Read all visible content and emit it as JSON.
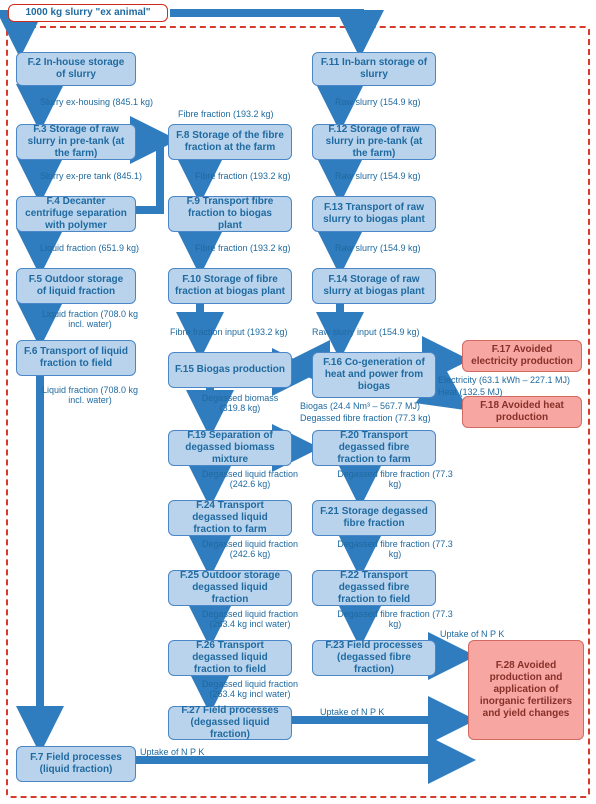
{
  "colors": {
    "node_blue": "#b9d3ec",
    "node_red": "#f7a6a1",
    "edge": "#2f7cbf",
    "border_dash": "#d63b2c"
  },
  "start": {
    "label": "1000 kg slurry \"ex animal\""
  },
  "nodes": {
    "f2": {
      "label": "F.2 In-house storage of slurry"
    },
    "f3": {
      "label": "F.3 Storage of raw slurry in pre-tank (at the farm)"
    },
    "f4": {
      "label": "F.4 Decanter centrifuge separation with polymer"
    },
    "f5": {
      "label": "F.5 Outdoor storage of liquid fraction"
    },
    "f6": {
      "label": "F.6 Transport of liquid fraction to field"
    },
    "f7": {
      "label": "F.7 Field processes (liquid fraction)"
    },
    "f8": {
      "label": "F.8 Storage of the fibre fraction at the farm"
    },
    "f9": {
      "label": "F.9 Transport fibre fraction to biogas plant"
    },
    "f10": {
      "label": "F.10 Storage of fibre fraction at biogas plant"
    },
    "f11": {
      "label": "F.11 In-barn storage of slurry"
    },
    "f12": {
      "label": "F.12 Storage of raw slurry in pre-tank (at the farm)"
    },
    "f13": {
      "label": "F.13 Transport of raw slurry to biogas plant"
    },
    "f14": {
      "label": "F.14 Storage of raw slurry at biogas plant"
    },
    "f15": {
      "label": "F.15 Biogas production"
    },
    "f16": {
      "label": "F.16 Co-generation of heat and power from biogas"
    },
    "f17": {
      "label": "F.17 Avoided electricity production"
    },
    "f18": {
      "label": "F.18 Avoided heat production"
    },
    "f19": {
      "label": "F.19 Separation of degassed biomass mixture"
    },
    "f20": {
      "label": "F.20 Transport degassed fibre fraction to farm"
    },
    "f21": {
      "label": "F.21 Storage degassed fibre fraction"
    },
    "f22": {
      "label": "F.22 Transport degassed fibre fraction to field"
    },
    "f23": {
      "label": "F.23 Field processes (degassed fibre fraction)"
    },
    "f24": {
      "label": "F.24 Transport degassed liquid fraction to farm"
    },
    "f25": {
      "label": "F.25 Outdoor storage degassed liquid fraction"
    },
    "f26": {
      "label": "F.26 Transport degassed liquid fraction to field"
    },
    "f27": {
      "label": "F.27 Field processes (degassed liquid fraction)"
    },
    "f28": {
      "label": "F.28 Avoided production and application of inorganic fertilizers and yield changes"
    }
  },
  "edges": {
    "e_start_f11": {
      "label": ""
    },
    "e_f2_f3": {
      "label": "Slurry ex-housing (845.1 kg)"
    },
    "e_f3_f4": {
      "label": "Slurry ex-pre tank (845.1)"
    },
    "e_f4_f5": {
      "label": "Liquid fraction (651.9 kg)"
    },
    "e_f5_f6": {
      "label": "Liquid fraction (708.0 kg incl. water)"
    },
    "e_f6_f7": {
      "label": "Liquid fraction (708.0 kg incl. water)"
    },
    "e_f4_f8": {
      "label": "Fibre fraction (193.2 kg)"
    },
    "e_f8_f9": {
      "label": "Fibre fraction (193.2 kg)"
    },
    "e_f9_f10": {
      "label": "Fibre fraction (193.2 kg)"
    },
    "e_f10_f15": {
      "label": "Fibre fraction input (193.2 kg)"
    },
    "e_f11_f12": {
      "label": "Raw slurry (154.9 kg)"
    },
    "e_f12_f13": {
      "label": "Raw slurry (154.9 kg)"
    },
    "e_f13_f14": {
      "label": "Raw slurry (154.9 kg)"
    },
    "e_f14_f15": {
      "label": "Raw slurry input (154.9 kg)"
    },
    "e_f15_f16": {
      "label": "Biogas (24.4 Nm³ – 567.7 MJ)"
    },
    "e_f16_f17": {
      "label": "Electricity (63.1 kWh – 227.1 MJ)"
    },
    "e_f16_f18": {
      "label": "Heat (132.5 MJ)"
    },
    "e_f15_f19": {
      "label": "Degassed biomass (319.8 kg)"
    },
    "e_f19_f20": {
      "label": "Degassed fibre fraction (77.3 kg)"
    },
    "e_f19_f24": {
      "label": "Degassed liquid fraction (242.6 kg)"
    },
    "e_f24_f25": {
      "label": "Degassed liquid fraction (242.6 kg)"
    },
    "e_f25_f26": {
      "label": "Degassed liquid fraction (263.4 kg incl water)"
    },
    "e_f26_f27": {
      "label": "Degassed liquid fraction (263.4 kg incl water)"
    },
    "e_f20_f21": {
      "label": "Degassed fibre fraction (77.3 kg)"
    },
    "e_f21_f22": {
      "label": "Degassed fibre fraction (77.3 kg)"
    },
    "e_f22_f23": {
      "label": "Degassed fibre fraction (77.3 kg)"
    },
    "e_f23_f28": {
      "label": "Uptake of N P K"
    },
    "e_f27_f28": {
      "label": "Uptake of N P K"
    },
    "e_f7_f28": {
      "label": "Uptake of N P K"
    }
  }
}
